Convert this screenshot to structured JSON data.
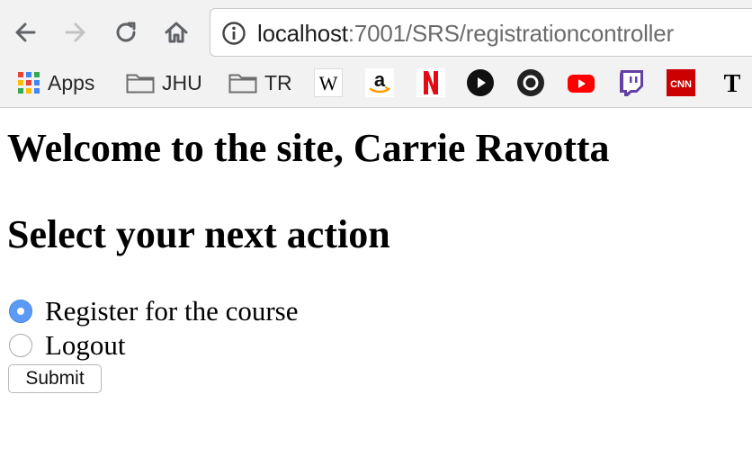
{
  "browser": {
    "url_host": "localhost",
    "url_path": ":7001/SRS/registrationcontroller",
    "bookmarks": [
      {
        "label": "Apps",
        "icon": "apps-grid-icon"
      },
      {
        "label": "JHU",
        "icon": "folder-icon"
      },
      {
        "label": "TR",
        "icon": "folder-icon"
      },
      {
        "label": "W",
        "icon": "wikipedia-icon"
      },
      {
        "label": "a",
        "icon": "amazon-icon"
      },
      {
        "label": "N",
        "icon": "netflix-icon"
      },
      {
        "label": "",
        "icon": "play-circle-icon"
      },
      {
        "label": "",
        "icon": "circle-record-icon"
      },
      {
        "label": "",
        "icon": "youtube-icon"
      },
      {
        "label": "",
        "icon": "twitch-icon"
      },
      {
        "label": "CNN",
        "icon": "cnn-icon"
      },
      {
        "label": "T",
        "icon": "nytimes-icon"
      }
    ]
  },
  "page": {
    "welcome": "Welcome to the site, Carrie Ravotta",
    "select_heading": "Select your next action",
    "options": [
      {
        "label": "Register for the course",
        "checked": true
      },
      {
        "label": "Logout",
        "checked": false
      }
    ],
    "submit_label": "Submit"
  },
  "colors": {
    "radio_checked": "#5b9bf6",
    "netflix_red": "#e50914",
    "youtube_red": "#ff0000",
    "twitch_purple": "#6441a5",
    "cnn_red": "#cc0000"
  }
}
